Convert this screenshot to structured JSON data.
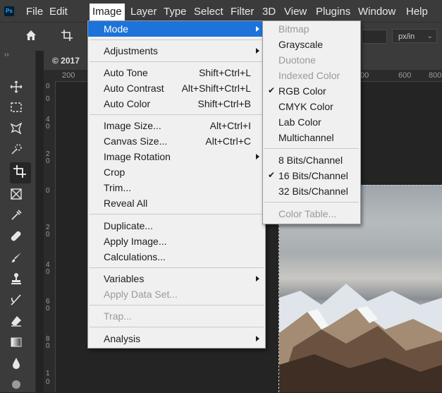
{
  "app": {
    "logo": "Ps"
  },
  "menubar": {
    "items": [
      "File",
      "Edit",
      "Image",
      "Layer",
      "Type",
      "Select",
      "Filter",
      "3D",
      "View",
      "Plugins",
      "Window",
      "Help"
    ]
  },
  "options_bar": {
    "home_icon": "home-icon",
    "crop_icon": "crop-icon",
    "unit_value": "px/in",
    "unit_chevron": "⌄"
  },
  "document": {
    "tab_title": "© 2017",
    "collapse_glyph": "››"
  },
  "rulers": {
    "h_ticks": [
      "200",
      "00",
      "600",
      "800"
    ],
    "v_ticks": [
      "0",
      "0",
      "4",
      "0",
      "2",
      "0",
      "0",
      "2",
      "0",
      "4",
      "0",
      "6",
      "0",
      "8",
      "0",
      "1",
      "0"
    ]
  },
  "image_menu": {
    "items": [
      {
        "label": "Mode",
        "shortcut": "",
        "submenu": true,
        "highlighted": true,
        "disabled": false
      },
      {
        "sep": true
      },
      {
        "label": "Adjustments",
        "shortcut": "",
        "submenu": true,
        "disabled": false
      },
      {
        "sep": true
      },
      {
        "label": "Auto Tone",
        "shortcut": "Shift+Ctrl+L",
        "disabled": false
      },
      {
        "label": "Auto Contrast",
        "shortcut": "Alt+Shift+Ctrl+L",
        "disabled": false
      },
      {
        "label": "Auto Color",
        "shortcut": "Shift+Ctrl+B",
        "disabled": false
      },
      {
        "sep": true
      },
      {
        "label": "Image Size...",
        "shortcut": "Alt+Ctrl+I",
        "disabled": false
      },
      {
        "label": "Canvas Size...",
        "shortcut": "Alt+Ctrl+C",
        "disabled": false
      },
      {
        "label": "Image Rotation",
        "shortcut": "",
        "submenu": true,
        "disabled": false
      },
      {
        "label": "Crop",
        "shortcut": "",
        "disabled": false
      },
      {
        "label": "Trim...",
        "shortcut": "",
        "disabled": false
      },
      {
        "label": "Reveal All",
        "shortcut": "",
        "disabled": false
      },
      {
        "sep": true
      },
      {
        "label": "Duplicate...",
        "shortcut": "",
        "disabled": false
      },
      {
        "label": "Apply Image...",
        "shortcut": "",
        "disabled": false
      },
      {
        "label": "Calculations...",
        "shortcut": "",
        "disabled": false
      },
      {
        "sep": true
      },
      {
        "label": "Variables",
        "shortcut": "",
        "submenu": true,
        "disabled": false
      },
      {
        "label": "Apply Data Set...",
        "shortcut": "",
        "disabled": true
      },
      {
        "sep": true
      },
      {
        "label": "Trap...",
        "shortcut": "",
        "disabled": true
      },
      {
        "sep": true
      },
      {
        "label": "Analysis",
        "shortcut": "",
        "submenu": true,
        "disabled": false
      }
    ]
  },
  "mode_submenu": {
    "items": [
      {
        "label": "Bitmap",
        "disabled": true,
        "checked": false
      },
      {
        "label": "Grayscale",
        "disabled": false,
        "checked": false
      },
      {
        "label": "Duotone",
        "disabled": true,
        "checked": false
      },
      {
        "label": "Indexed Color",
        "disabled": true,
        "checked": false
      },
      {
        "label": "RGB Color",
        "disabled": false,
        "checked": true
      },
      {
        "label": "CMYK Color",
        "disabled": false,
        "checked": false
      },
      {
        "label": "Lab Color",
        "disabled": false,
        "checked": false
      },
      {
        "label": "Multichannel",
        "disabled": false,
        "checked": false
      },
      {
        "sep": true
      },
      {
        "label": "8 Bits/Channel",
        "disabled": false,
        "checked": false
      },
      {
        "label": "16 Bits/Channel",
        "disabled": false,
        "checked": true
      },
      {
        "label": "32 Bits/Channel",
        "disabled": false,
        "checked": false
      },
      {
        "sep": true
      },
      {
        "label": "Color Table...",
        "disabled": true,
        "checked": false
      }
    ],
    "check_glyph": "✔"
  },
  "colors": {
    "menubar_bg": "#3b3b3b",
    "menu_bg": "#f0f0f0",
    "highlight": "#1c73d9",
    "canvas_bg": "#232323"
  }
}
